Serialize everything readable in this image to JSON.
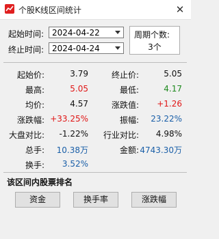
{
  "window": {
    "title": "个股K线区间统计",
    "close": "✕"
  },
  "range": {
    "start_label": "起始时间:",
    "start_value": "2024-04-22",
    "end_label": "终止时间:",
    "end_value": "2024-04-24"
  },
  "period": {
    "label": "周期个数:",
    "value": "3个"
  },
  "stats": {
    "start_price": {
      "label": "起始价:",
      "value": "3.79"
    },
    "end_price": {
      "label": "终止价:",
      "value": "5.05"
    },
    "high": {
      "label": "最高:",
      "value": "5.05"
    },
    "low": {
      "label": "最低:",
      "value": "4.17"
    },
    "avg": {
      "label": "均价:",
      "value": "4.57"
    },
    "change": {
      "label": "涨跌值:",
      "value": "+1.26"
    },
    "change_pct": {
      "label": "涨跌幅:",
      "value": "+33.25%"
    },
    "amplitude": {
      "label": "振幅:",
      "value": "23.22%"
    },
    "index_compare": {
      "label": "大盘对比:",
      "value": "-1.22%"
    },
    "industry_compare": {
      "label": "行业对比:",
      "value": "4.98%"
    },
    "volume": {
      "label": "总手:",
      "value": "10.38万"
    },
    "amount": {
      "label": "金额:",
      "value": "4743.30万"
    },
    "turnover": {
      "label": "换手:",
      "value": "3.52%"
    }
  },
  "ranking": {
    "title": "该区间内股票排名",
    "buttons": [
      "资金",
      "换手率",
      "涨跌幅"
    ]
  },
  "colors": {
    "up": "#e01616",
    "down": "#1e8a1e",
    "neutral_blue": "#1a5fa8"
  }
}
